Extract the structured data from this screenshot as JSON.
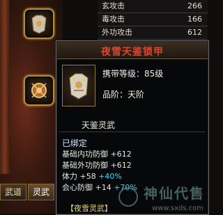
{
  "left_panel": {
    "tabs": [
      "武道",
      "灵武"
    ]
  },
  "stats": [
    {
      "label": "玄攻击",
      "value": "266"
    },
    {
      "label": "毒攻击",
      "value": "166"
    },
    {
      "label": "外功攻击",
      "value": "612"
    }
  ],
  "tooltip": {
    "title": "夜雪天鉴锁甲",
    "level_label": "携带等级：85级",
    "grade_label": "品阶：天阶",
    "set_name": "天鉴灵武",
    "bound": "已绑定",
    "attributes": [
      {
        "name": "基础内功防御",
        "plus": "+612",
        "bonus": ""
      },
      {
        "name": "基础外功防御",
        "plus": "+612",
        "bonus": ""
      },
      {
        "name": "体力",
        "plus": "+58",
        "bonus": "+40%"
      },
      {
        "name": "会心防御",
        "plus": "+14",
        "bonus": "+70%"
      }
    ],
    "footer": "【夜雪灵武】"
  },
  "watermark": {
    "text": "神仙代售",
    "url": "www.sxds.com"
  },
  "colors": {
    "title_red": "#e0452a",
    "bonus_cyan": "#39d6ff",
    "gold_border": "#b58b3a"
  }
}
